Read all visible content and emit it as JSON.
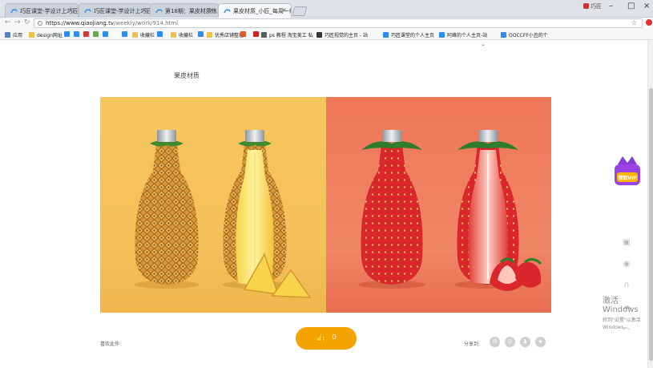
{
  "browser": {
    "tabs": [
      {
        "label": "巧匠课堂-学设计上巧匠",
        "active": false
      },
      {
        "label": "巧匠课堂-学设计上巧匠",
        "active": false
      },
      {
        "label": "第18期：果皮材质练习",
        "active": false
      },
      {
        "label": "果皮材质_小匠_每周一练",
        "active": true
      }
    ],
    "user_label": "巧匠",
    "url_host": "https://www.qiaojiang.tv",
    "url_path": "/weekly/work/914.html",
    "bookmarks": [
      {
        "label": "应用",
        "color": "#5b7fbf"
      },
      {
        "label": "design网址",
        "color": "#f2c04e"
      },
      {
        "label": "",
        "color": "#2d8cf0"
      },
      {
        "label": "",
        "color": "#2d8cf0"
      },
      {
        "label": "",
        "color": "#d93838"
      },
      {
        "label": "",
        "color": "#6aa84f"
      },
      {
        "label": "",
        "color": "#2d8cf0"
      },
      {
        "label": "",
        "color": "#ffffff"
      },
      {
        "label": "",
        "color": "#2d8cf0"
      },
      {
        "label": "收藏栏",
        "color": "#f2c04e"
      },
      {
        "label": "",
        "color": "#2d8cf0"
      },
      {
        "label": "收藏栏",
        "color": "#f2c04e"
      },
      {
        "label": "",
        "color": "#2d8cf0"
      },
      {
        "label": "优秀店铺整理",
        "color": "#f2c04e"
      },
      {
        "label": "",
        "color": "#e05a2b"
      },
      {
        "label": "",
        "color": "#cc2222"
      },
      {
        "label": "ps 教程 淘宝美工 私",
        "color": "#5b5b5b"
      },
      {
        "label": "巧匠视觉的主页 - 站",
        "color": "#333333"
      },
      {
        "label": "巧匠课堂的个人主页",
        "color": "#2d8cf0"
      },
      {
        "label": "阿峰的个人主页-站",
        "color": "#2d8cf0"
      },
      {
        "label": "OOCCFF小丑的个",
        "color": "#2d8cf0"
      }
    ]
  },
  "page": {
    "work_title": "果皮材质",
    "likers_label": "喜欢此作:",
    "like_count": "0",
    "share_label": "分享到:",
    "share_icons": [
      "wechat-icon",
      "weibo-icon",
      "qq-icon",
      "qzone-icon"
    ],
    "vip_label": "领取VIP",
    "side_icons": [
      "gift-icon",
      "chat-icon",
      "headset-icon",
      "cloud-icon",
      "top-arrow-icon"
    ],
    "accent": "#f5a300"
  },
  "artwork_colors": {
    "pineapple_bg": "#f4c05a",
    "strawberry_bg": "#ee7758"
  },
  "os_watermark": {
    "line1": "激活 Windows",
    "line2": "转到\"设置\"以激活 Windows。"
  }
}
